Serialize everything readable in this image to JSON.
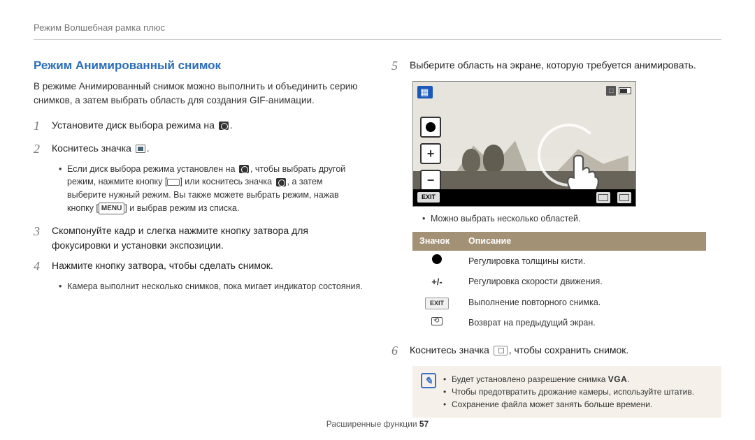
{
  "header": "Режим Волшебная рамка плюс",
  "title": "Режим Анимированный снимок",
  "intro": "В режиме Анимированный снимок можно выполнить и объединить серию снимков, а затем выбрать область для создания GIF-анимации.",
  "steps": {
    "s1": "Установите диск выбора режима на",
    "s2": "Коснитесь значка",
    "s2_note": "Если диск выбора режима установлен на , чтобы выбрать другой режим, нажмите кнопку [ ] или коснитесь значка , а затем выберите нужный режим. Вы также можете выбрать режим, нажав кнопку [ ] и выбрав режим из списка.",
    "s3": "Скомпонуйте кадр и слегка нажмите кнопку затвора для фокусировки и установки экспозиции.",
    "s4": "Нажмите кнопку затвора, чтобы сделать снимок.",
    "s4_note": "Камера выполнит несколько снимков, пока мигает индикатор состояния.",
    "s5": "Выберите область на экране, которую требуется анимировать.",
    "s5_note": "Можно выбрать несколько областей.",
    "s6_a": "Коснитесь значка",
    "s6_b": ", чтобы сохранить снимок."
  },
  "screenshot": {
    "exit": "EXIT",
    "badge": "⬚",
    "plus": "+",
    "minus": "−"
  },
  "table": {
    "hdr_icon": "Значок",
    "hdr_desc": "Описание",
    "r1_icon": "+/-",
    "r1": "Регулировка толщины кисти.",
    "r2": "Регулировка скорости движения.",
    "r3_exit": "EXIT",
    "r3": "Выполнение повторного снимка.",
    "r4": "Возврат на предыдущий экран."
  },
  "note": {
    "n1a": "Будет установлено разрешение снимка",
    "n1b": ".",
    "vga": "VGA",
    "n2": "Чтобы предотвратить дрожание камеры, используйте штатив.",
    "n3": "Сохранение файла может занять больше времени."
  },
  "menu_label": "MENU",
  "footer_a": "Расширенные функции  ",
  "footer_b": "57"
}
